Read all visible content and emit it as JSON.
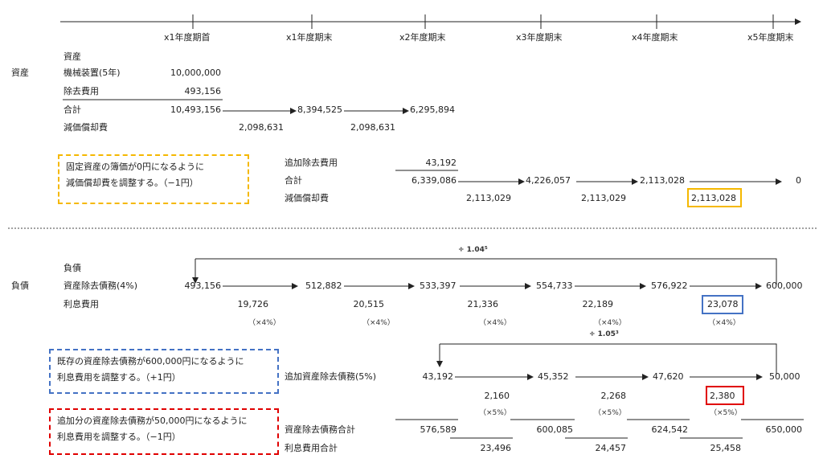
{
  "timeline": {
    "labels": [
      "x1年度期首",
      "x1年度期末",
      "x2年度期末",
      "x3年度期末",
      "x4年度期末",
      "x5年度期末"
    ]
  },
  "assets": {
    "section_label": "資産",
    "header": "資産",
    "machine_label": "機械装置(5年)",
    "machine_value": "10,000,000",
    "removal_cost_label": "除去費用",
    "removal_cost_value": "493,156",
    "total_label": "合計",
    "totals": [
      "10,493,156",
      "8,394,525",
      "6,295,894"
    ],
    "depreciation_label": "減価償却費",
    "depreciations": [
      "2,098,631",
      "2,098,631"
    ],
    "additional_removal_label": "追加除去費用",
    "additional_removal_value": "43,192",
    "total2_label": "合計",
    "totals2": [
      "6,339,086",
      "4,226,057",
      "2,113,028",
      "0"
    ],
    "depreciation2_label": "減価償却費",
    "depreciations2": [
      "2,113,029",
      "2,113,029",
      "2,113,028"
    ],
    "note": [
      "固定資産の簿価が0円になるように",
      "減価償却費を調整する。（−1円）"
    ]
  },
  "liabilities": {
    "section_label": "負債",
    "header": "負債",
    "aro_label": "資産除去債務(4%)",
    "aro_values": [
      "493,156",
      "512,882",
      "533,397",
      "554,733",
      "576,922",
      "600,000"
    ],
    "interest_label": "利息費用",
    "interest_values": [
      "19,726",
      "20,515",
      "21,336",
      "22,189",
      "23,078"
    ],
    "rate_note": "（×4%）",
    "discount_label": "÷ 1.04⁵",
    "note1": [
      "既存の資産除去債務が600,000円になるように",
      "利息費用を調整する。（+1円）"
    ],
    "add_aro_label": "追加資産除去債務(5%)",
    "add_aro_values": [
      "43,192",
      "45,352",
      "47,620",
      "50,000"
    ],
    "add_interest_values": [
      "2,160",
      "2,268",
      "2,380"
    ],
    "rate_note2": "（×5%）",
    "discount_label2": "÷ 1.05³",
    "note2": [
      "追加分の資産除去債務が50,000円になるように",
      "利息費用を調整する。（−1円）"
    ],
    "aro_total_label": "資産除去債務合計",
    "aro_totals": [
      "576,589",
      "600,085",
      "624,542",
      "650,000"
    ],
    "interest_total_label": "利息費用合計",
    "interest_totals": [
      "23,496",
      "24,457",
      "25,458"
    ]
  },
  "colors": {
    "yellow": "#f5b800",
    "blue": "#4472c4",
    "red": "#e00000",
    "line": "#222222"
  }
}
